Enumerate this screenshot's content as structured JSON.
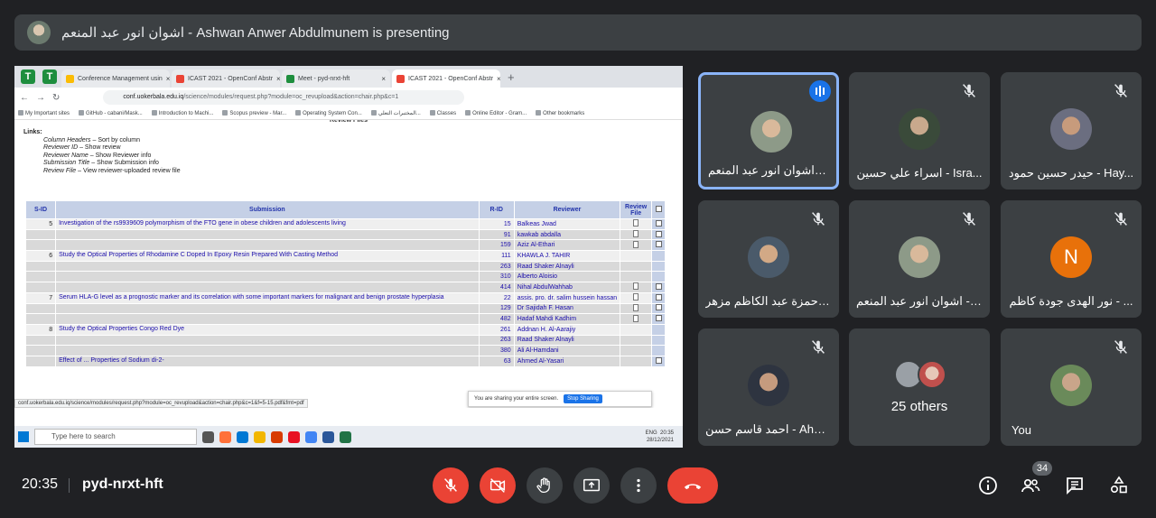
{
  "presenter_bar": {
    "text": "اشوان انور عبد المنعم - Ashwan Anwer Abdulmunem is presenting"
  },
  "browser": {
    "tabs": [
      {
        "label": "Conference Management usin",
        "color": "#fbbc04"
      },
      {
        "label": "ICAST 2021 - OpenConf Abstr",
        "color": "#ea4335"
      },
      {
        "label": "Meet - pyd-nrxt-hft",
        "color": "#1e8e3e"
      },
      {
        "label": "ICAST 2021 - OpenConf Abstr",
        "color": "#ea4335"
      }
    ],
    "url_host": "conf.uokerbala.edu.iq",
    "url_path": "/science/modules/request.php?module=oc_revupload&action=chair.php&c=1",
    "bookmarks": [
      "My Important sites",
      "GitHub - cabani/Mask...",
      "Introduction to Machi...",
      "Scopus preview - Mar...",
      "Operating System Con...",
      "المختبرات التعلي...",
      "Classes",
      "Online Editor - Gram...",
      "Other bookmarks"
    ]
  },
  "page": {
    "title": "Review Files",
    "links_heading": "Links:",
    "links": [
      {
        "term": "Column Headers",
        "desc": " – Sort by column"
      },
      {
        "term": "Reviewer ID",
        "desc": " – Show review"
      },
      {
        "term": "Reviewer Name",
        "desc": " – Show Reviewer info"
      },
      {
        "term": "Submission Title",
        "desc": " – Show Submission info"
      },
      {
        "term": "Review File",
        "desc": " – View reviewer-uploaded review file"
      }
    ],
    "table": {
      "headers": {
        "sid": "S-ID",
        "submission": "Submission",
        "rid": "R-ID",
        "reviewer": "Reviewer",
        "file": "Review File"
      },
      "rows": [
        {
          "sid": "5",
          "submission": "Investigation of the rs9939609 polymorphism of the FTO gene in obese children and adolescents living",
          "rid": "15",
          "reviewer": "Balkeas Jwad",
          "file": true,
          "check": true
        },
        {
          "sid": "",
          "submission": "",
          "rid": "91",
          "reviewer": "kawkab abdalla",
          "file": true,
          "check": true
        },
        {
          "sid": "",
          "submission": "",
          "rid": "159",
          "reviewer": "Aziz Al-Ethari",
          "file": true,
          "check": true
        },
        {
          "sid": "6",
          "submission": "Study the Optical Properties of Rhodamine C Doped In Epoxy Resin Prepared With Casting Method",
          "rid": "111",
          "reviewer": "KHAWLA J. TAHIR",
          "file": false,
          "check": false
        },
        {
          "sid": "",
          "submission": "",
          "rid": "263",
          "reviewer": "Raad Shaker Alnayli",
          "file": false,
          "check": false
        },
        {
          "sid": "",
          "submission": "",
          "rid": "310",
          "reviewer": "Alberto Aloisio",
          "file": false,
          "check": false
        },
        {
          "sid": "",
          "submission": "",
          "rid": "414",
          "reviewer": "Nihal AbdulWahhab",
          "file": true,
          "check": true
        },
        {
          "sid": "7",
          "submission": "Serum HLA-G level as a prognostic marker and its correlation with some important markers for malignant and benign prostate hyperplasia",
          "rid": "22",
          "reviewer": "assis. pro. dr. salim hussein hassan",
          "file": true,
          "check": true
        },
        {
          "sid": "",
          "submission": "",
          "rid": "129",
          "reviewer": "Dr Sajidah F. Hasan",
          "file": true,
          "check": true
        },
        {
          "sid": "",
          "submission": "",
          "rid": "482",
          "reviewer": "Hadaf Mahdi Kadhim",
          "file": true,
          "check": true
        },
        {
          "sid": "8",
          "submission": "Study the Optical Properties Congo Red Dye",
          "rid": "261",
          "reviewer": "Addnan H. Al-Aarajiy",
          "file": false,
          "check": false
        },
        {
          "sid": "",
          "submission": "",
          "rid": "263",
          "reviewer": "Raad Shaker Alnayli",
          "file": false,
          "check": false
        },
        {
          "sid": "",
          "submission": "",
          "rid": "380",
          "reviewer": "Ali Al-Hamdani",
          "file": false,
          "check": false
        },
        {
          "sid": "",
          "submission": "Effect of ... Properties of Sodium di-2-",
          "rid": "63",
          "reviewer": "Ahmed Al-Yasari",
          "file": false,
          "check": true
        }
      ]
    },
    "share_popup": {
      "text": "You are sharing your entire screen.",
      "stop": "Stop Sharing"
    },
    "status_url": "conf.uokerbala.edu.iq/science/modules/request.php?module=oc_revupload&action=chair.php&c=1&f=5-15.pdf&fmt=pdf",
    "taskbar": {
      "search": "Type here to search",
      "lang": "ENG",
      "time": "20:35",
      "date": "28/12/2021"
    }
  },
  "participants": [
    {
      "name": "اشوان انور عبد المنعم - ...",
      "speaking": true
    },
    {
      "name": "اسراء علي حسين - Isra...",
      "speaking": false
    },
    {
      "name": "حيدر حسين حمود - Hay...",
      "speaking": false
    },
    {
      "name": "حمزة عبد الكاظم مزهر - ...",
      "speaking": false
    },
    {
      "name": "اشوان انور عبد المنعم - ...",
      "speaking": false
    },
    {
      "name": "نور الهدى جودة كاظم - ...",
      "speaking": false,
      "initial": "N"
    },
    {
      "name": "احمد قاسم حسن - Ahm...",
      "speaking": false
    },
    {
      "name": "25 others",
      "speaking": false
    },
    {
      "name": "You",
      "speaking": false
    }
  ],
  "bottom_bar": {
    "time": "20:35",
    "meeting_code": "pyd-nrxt-hft",
    "participant_count": "34"
  },
  "colors": {
    "background": "#202124",
    "tile": "#3c4043",
    "danger": "#ea4335",
    "accent": "#1a73e8"
  }
}
